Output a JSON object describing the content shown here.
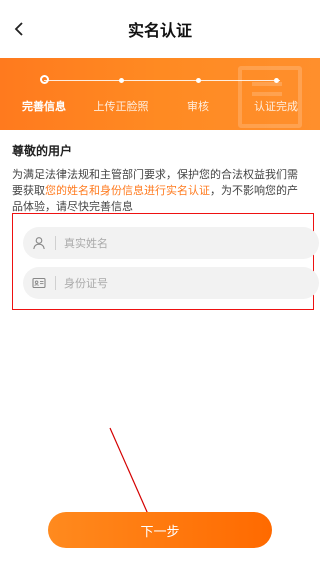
{
  "header": {
    "title": "实名认证"
  },
  "steps": [
    {
      "label": "完善信息",
      "active": true
    },
    {
      "label": "上传正脸照",
      "active": false
    },
    {
      "label": "审核",
      "active": false
    },
    {
      "label": "认证完成",
      "active": false
    }
  ],
  "section_title": "尊敬的用户",
  "description": {
    "part1": "为满足法律法规和主管部门要求，保护您的合法权益我们需要获取",
    "highlight": "您的姓名和身份信息进行实名认证",
    "part2": "，为不影响您的产品体验，请尽快完善信息"
  },
  "form": {
    "name_placeholder": "真实姓名",
    "name_value": "",
    "id_placeholder": "身份证号",
    "id_value": ""
  },
  "next_button": {
    "label": "下一步"
  },
  "colors": {
    "accent": "#ff7a1e",
    "highlight_border": "#ee1111"
  },
  "icons": {
    "back": "chevron-left-icon",
    "name": "user-icon",
    "id": "id-card-icon"
  }
}
